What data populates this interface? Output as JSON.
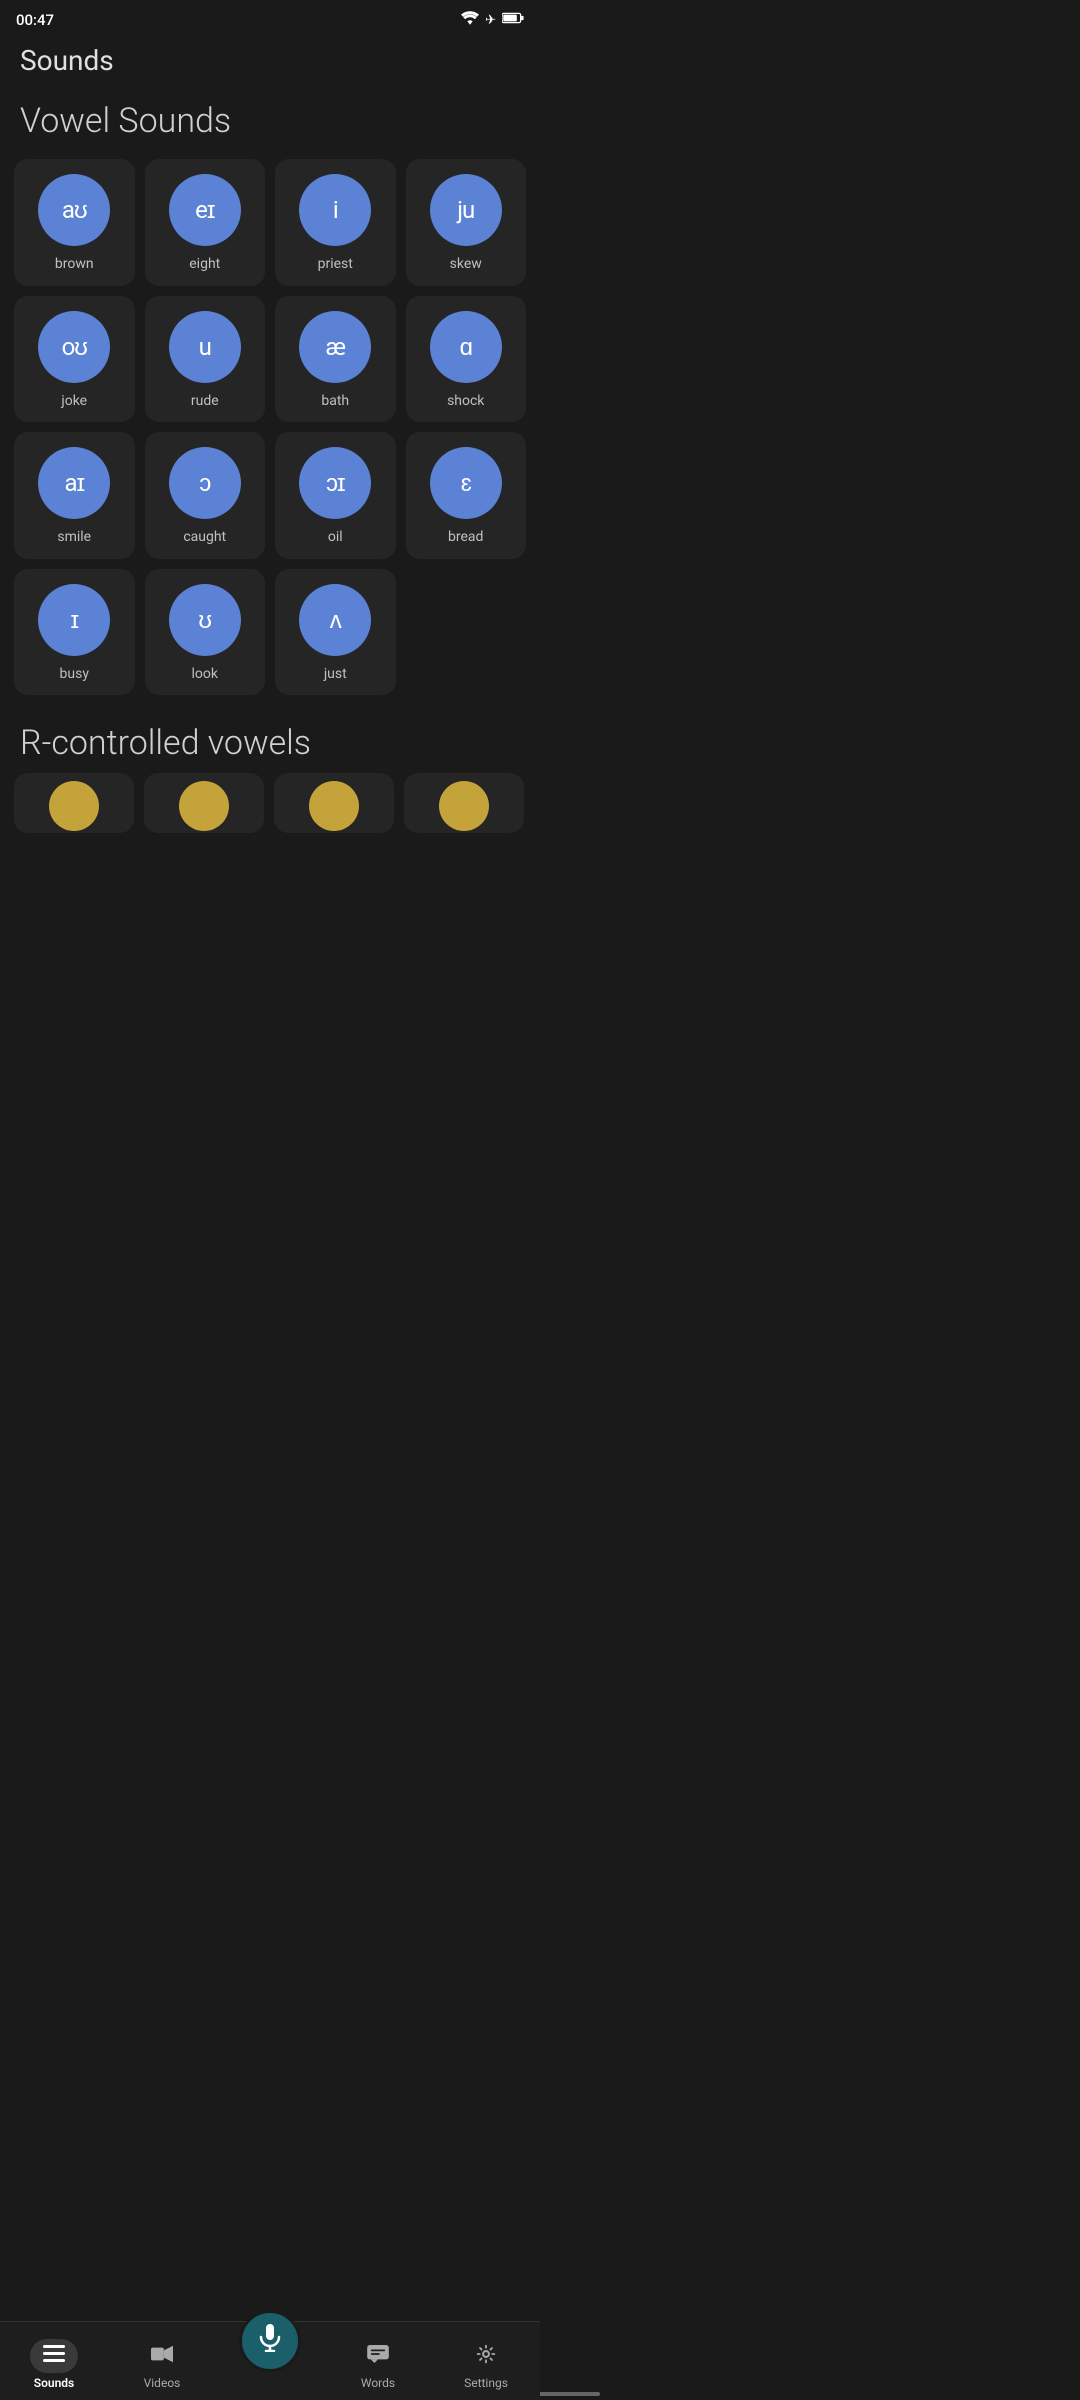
{
  "statusBar": {
    "time": "00:47",
    "wifiIcon": "wifi",
    "airplaneIcon": "✈",
    "batteryIcon": "🔋"
  },
  "pageTitle": "Sounds",
  "sections": [
    {
      "title": "Vowel Sounds",
      "rows": [
        [
          {
            "symbol": "aʊ",
            "label": "brown"
          },
          {
            "symbol": "eɪ",
            "label": "eight"
          },
          {
            "symbol": "i",
            "label": "priest"
          },
          {
            "symbol": "ju",
            "label": "skew"
          }
        ],
        [
          {
            "symbol": "oʊ",
            "label": "joke"
          },
          {
            "symbol": "u",
            "label": "rude"
          },
          {
            "symbol": "æ",
            "label": "bath"
          },
          {
            "symbol": "ɑ",
            "label": "shock"
          }
        ],
        [
          {
            "symbol": "aɪ",
            "label": "smile"
          },
          {
            "symbol": "ɔ",
            "label": "caught"
          },
          {
            "symbol": "ɔɪ",
            "label": "oil"
          },
          {
            "symbol": "ɛ",
            "label": "bread"
          }
        ],
        [
          {
            "symbol": "ɪ",
            "label": "busy"
          },
          {
            "symbol": "ʊ",
            "label": "look"
          },
          {
            "symbol": "ʌ",
            "label": "just"
          },
          null
        ]
      ]
    }
  ],
  "rControlledTitle": "R-controlled vowels",
  "bottomNav": {
    "items": [
      {
        "id": "sounds",
        "label": "Sounds",
        "icon": "list",
        "active": true
      },
      {
        "id": "videos",
        "label": "Videos",
        "icon": "video",
        "active": false
      },
      {
        "id": "words",
        "label": "Words",
        "icon": "chat",
        "active": false
      },
      {
        "id": "settings",
        "label": "Settings",
        "icon": "gear",
        "active": false
      }
    ],
    "micLabel": ""
  }
}
